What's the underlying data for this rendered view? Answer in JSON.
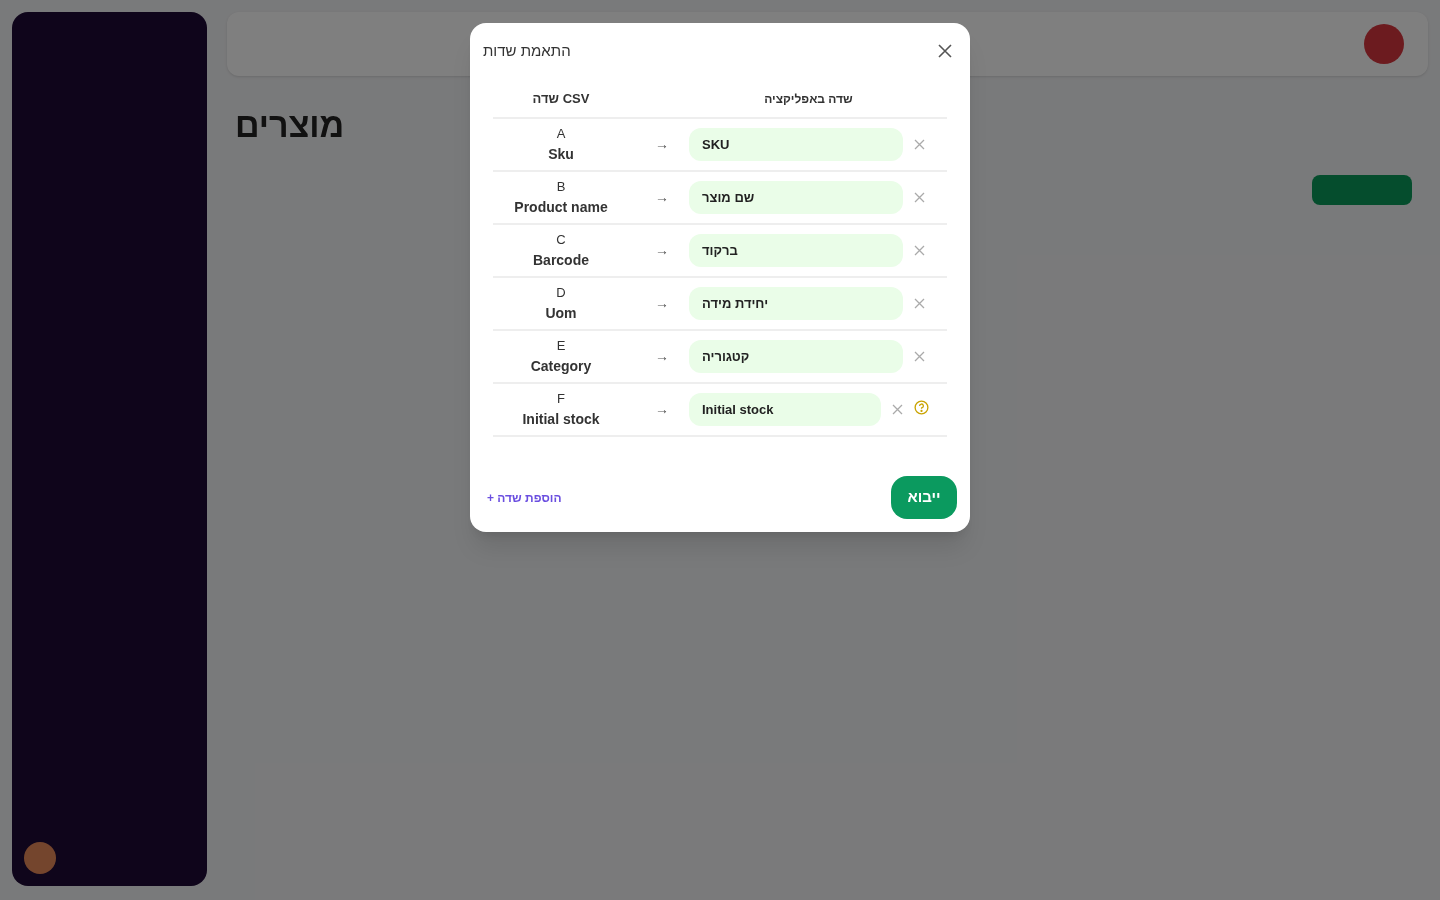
{
  "page": {
    "title": "מוצרים"
  },
  "modal": {
    "title": "התאמת שדות",
    "columns": [
      "שדה באפליקציה",
      "שדה CSV"
    ],
    "rows": [
      {
        "letter": "A",
        "csv_name": "Sku",
        "arrow": "→",
        "app_field": "SKU",
        "warning": false
      },
      {
        "letter": "B",
        "csv_name": "Product name",
        "arrow": "→",
        "app_field": "שם מוצר",
        "warning": false
      },
      {
        "letter": "C",
        "csv_name": "Barcode",
        "arrow": "→",
        "app_field": "ברקוד",
        "warning": false
      },
      {
        "letter": "D",
        "csv_name": "Uom",
        "arrow": "→",
        "app_field": "יחידת מידה",
        "warning": false
      },
      {
        "letter": "E",
        "csv_name": "Category",
        "arrow": "→",
        "app_field": "קטגוריה",
        "warning": false
      },
      {
        "letter": "F",
        "csv_name": "Initial stock",
        "arrow": "→",
        "app_field": "Initial stock",
        "warning": true
      }
    ],
    "add_field": "+ הוספת שדה",
    "import_button": "ייבוא"
  }
}
